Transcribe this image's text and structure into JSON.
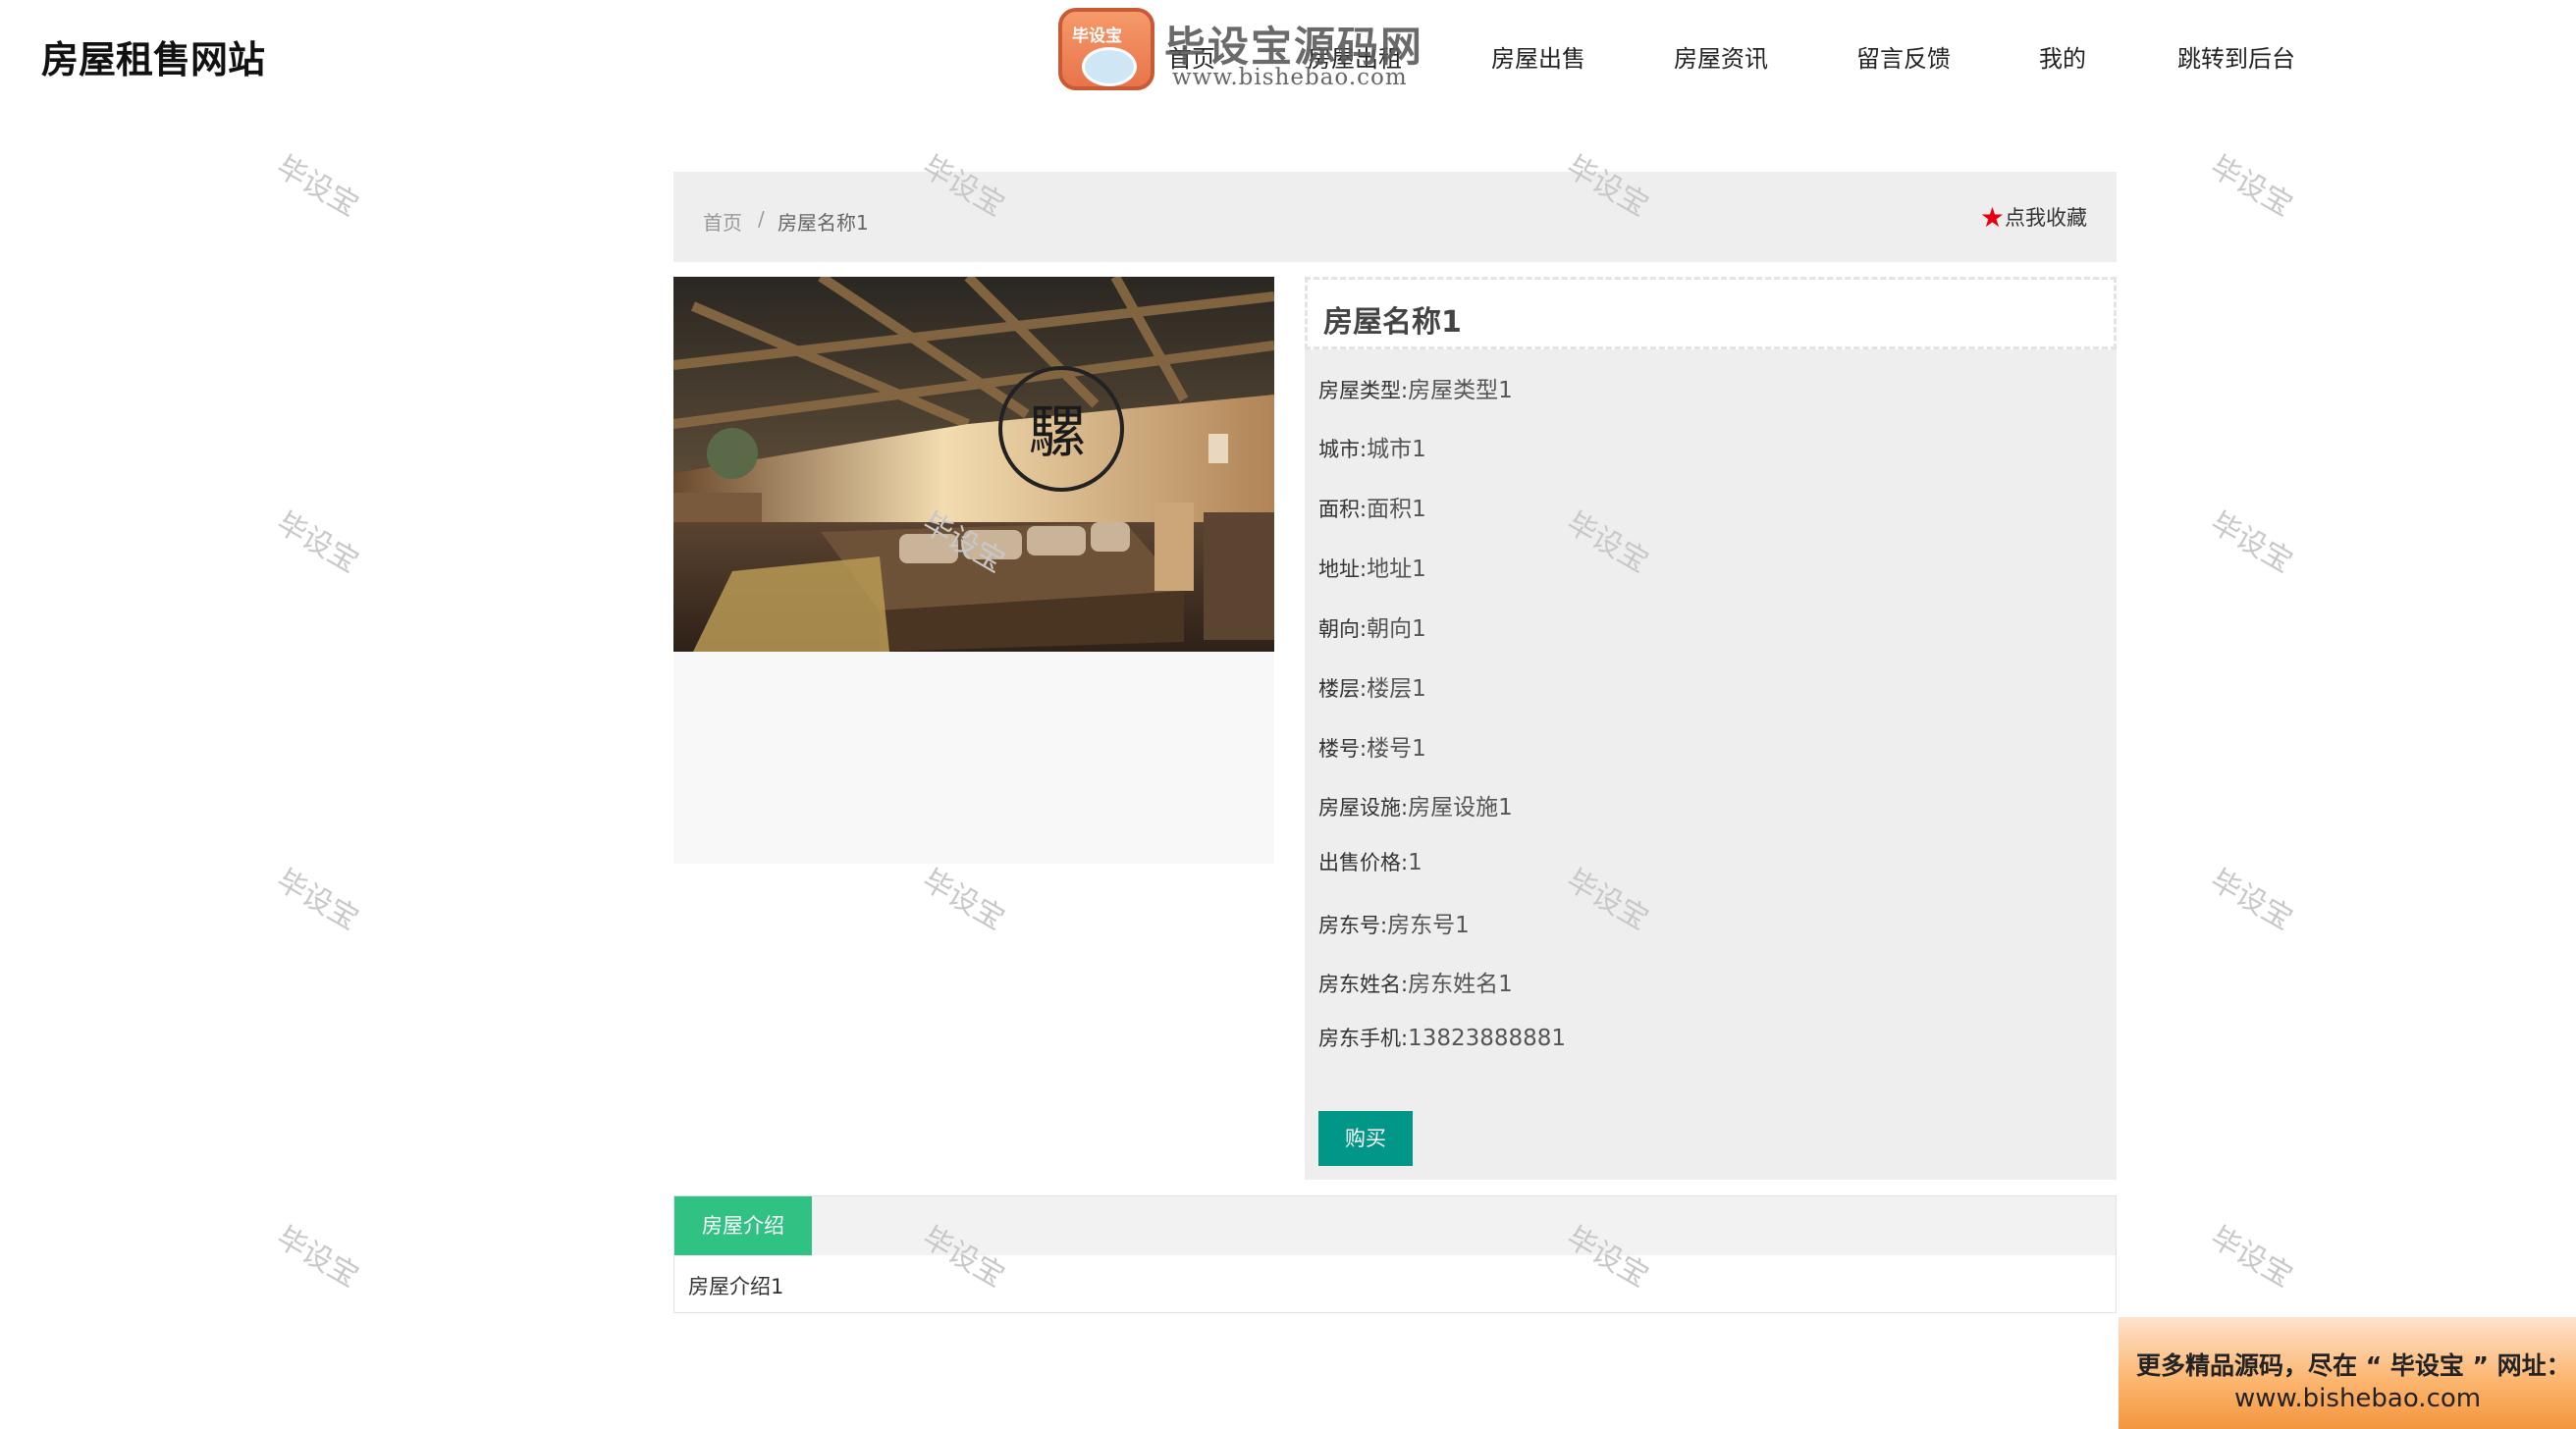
{
  "site": {
    "title": "房屋租售网站"
  },
  "nav": {
    "items": [
      {
        "label": "首页"
      },
      {
        "label": "房屋出租"
      },
      {
        "label": "房屋出售"
      },
      {
        "label": "房屋资讯"
      },
      {
        "label": "留言反馈"
      },
      {
        "label": "我的"
      },
      {
        "label": "跳转到后台"
      }
    ]
  },
  "watermark": {
    "logo_badge": "毕设宝",
    "logo_name": "毕设宝源码网",
    "logo_url": "www.bishebao.com",
    "tile_text": "毕设宝"
  },
  "breadcrumb": {
    "home": "首页",
    "separator": "/",
    "current": "房屋名称1",
    "favorite_label": "点我收藏",
    "favorite_icon": "star-icon"
  },
  "gallery": {
    "image_subject": "attic-bedroom-photo",
    "sign_text": "騾"
  },
  "house": {
    "name": "房屋名称1",
    "attributes": [
      {
        "label": "房屋类型:",
        "value": "房屋类型1"
      },
      {
        "label": "城市:",
        "value": "城市1"
      },
      {
        "label": "面积:",
        "value": "面积1"
      },
      {
        "label": "地址:",
        "value": "地址1"
      },
      {
        "label": "朝向:",
        "value": "朝向1"
      },
      {
        "label": "楼层:",
        "value": "楼层1"
      },
      {
        "label": "楼号:",
        "value": "楼号1"
      },
      {
        "label": "房屋设施:",
        "value": "房屋设施1"
      },
      {
        "label": "出售价格:",
        "value": "1"
      },
      {
        "label": "房东号:",
        "value": "房东号1"
      },
      {
        "label": "房东姓名:",
        "value": "房东姓名1"
      },
      {
        "label": "房东手机:",
        "value": "13823888881"
      }
    ],
    "buy_label": "购买"
  },
  "tabs": {
    "active_label": "房屋介绍",
    "content": "房屋介绍1"
  },
  "promo": {
    "line1": "更多精品源码，尽在 “ 毕设宝 ” 网址：",
    "line2": "www.bishebao.com"
  },
  "colors": {
    "buy_button": "#009688",
    "active_tab": "#2fc283",
    "favorite_star": "#e60012",
    "panel_bg": "#eeeeee"
  }
}
